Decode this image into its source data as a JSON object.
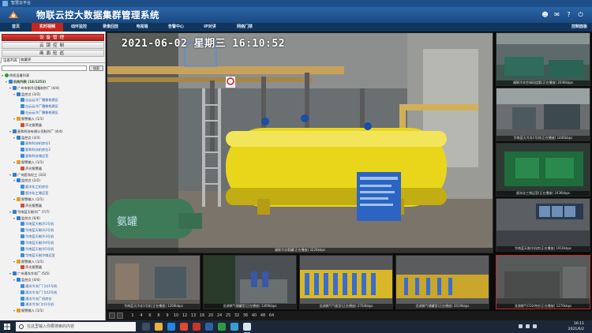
{
  "window": {
    "title": "智慧云平台"
  },
  "header": {
    "title": "物联云控大数据集群管理系统"
  },
  "nav": {
    "items": [
      "首页",
      "实时视频",
      "动环监控",
      "录像回放",
      "电视墙",
      "告警中心",
      "IP对讲",
      "网络门禁"
    ],
    "active_index": 1,
    "right_label": "控制面板"
  },
  "sidebar": {
    "buttons": [
      "设备管理",
      "云镜控制",
      "画面轮巡"
    ],
    "active_button": 0,
    "tabs": [
      "设备列表",
      "收藏夹"
    ],
    "search_button": "搜索",
    "tree": [
      {
        "level": 0,
        "icon": "person",
        "text": "授权设备列表",
        "style": "normal"
      },
      {
        "level": 1,
        "icon": "folder",
        "text": "机构列表 (18/1253)",
        "style": "bold"
      },
      {
        "level": 2,
        "icon": "folder",
        "text": "广州市制冷设备制作厂 (4/4)",
        "style": "normal"
      },
      {
        "level": 3,
        "icon": "folder",
        "text": "监控点 (3/3)",
        "style": "normal"
      },
      {
        "level": 4,
        "icon": "cam",
        "text": "自云云冷厂摄像枪建区",
        "style": "blue"
      },
      {
        "level": 4,
        "icon": "cam",
        "text": "白云云冷厂摄像枪建区",
        "style": "blue"
      },
      {
        "level": 4,
        "icon": "cam",
        "text": "白云云冷厂摄像枪建区",
        "style": "blue"
      },
      {
        "level": 3,
        "icon": "alarm",
        "text": "报警输入 (1/1)",
        "style": "normal"
      },
      {
        "level": 4,
        "icon": "bell",
        "text": "声光报警器",
        "style": "normal"
      },
      {
        "level": 2,
        "icon": "folder",
        "text": "星和科技有限公司制冷厂 (4/4)",
        "style": "normal"
      },
      {
        "level": 3,
        "icon": "folder",
        "text": "监控点 (3/3)",
        "style": "normal"
      },
      {
        "level": 4,
        "icon": "cam",
        "text": "星和科技机房仓1",
        "style": "blue"
      },
      {
        "level": 4,
        "icon": "cam",
        "text": "星和科技机房仓2",
        "style": "blue"
      },
      {
        "level": 4,
        "icon": "cam",
        "text": "星和科技储运室",
        "style": "blue"
      },
      {
        "level": 3,
        "icon": "alarm",
        "text": "报警输入 (1/1)",
        "style": "normal"
      },
      {
        "level": 4,
        "icon": "bell",
        "text": "声光报警器",
        "style": "normal"
      },
      {
        "level": 2,
        "icon": "folder",
        "text": "广州超冻化工 (3/3)",
        "style": "normal"
      },
      {
        "level": 3,
        "icon": "folder",
        "text": "监控点 (2/2)",
        "style": "normal"
      },
      {
        "level": 4,
        "icon": "cam",
        "text": "超冻化工机房仓",
        "style": "blue"
      },
      {
        "level": 4,
        "icon": "cam",
        "text": "超冻化工储运室",
        "style": "blue"
      },
      {
        "level": 3,
        "icon": "alarm",
        "text": "报警输入 (1/1)",
        "style": "normal"
      },
      {
        "level": 4,
        "icon": "bell",
        "text": "声光报警器",
        "style": "normal"
      },
      {
        "level": 2,
        "icon": "folder",
        "text": "华南蓝天制冷厂 (7/7)",
        "style": "normal"
      },
      {
        "level": 3,
        "icon": "folder",
        "text": "监控点 (6/6)",
        "style": "normal"
      },
      {
        "level": 4,
        "icon": "cam",
        "text": "华南蓝天制冷1号机",
        "style": "blue"
      },
      {
        "level": 4,
        "icon": "cam",
        "text": "华南蓝天制冷2号机",
        "style": "blue"
      },
      {
        "level": 4,
        "icon": "cam",
        "text": "华南蓝天制冷3号机",
        "style": "blue"
      },
      {
        "level": 4,
        "icon": "cam",
        "text": "华南蓝天制冷4号机",
        "style": "blue"
      },
      {
        "level": 4,
        "icon": "cam",
        "text": "华南蓝天制冷5号机",
        "style": "blue"
      },
      {
        "level": 4,
        "icon": "cam",
        "text": "华南蓝天制冷储运室",
        "style": "blue"
      },
      {
        "level": 3,
        "icon": "alarm",
        "text": "报警输入 (1/1)",
        "style": "normal"
      },
      {
        "level": 4,
        "icon": "bell",
        "text": "声光报警器",
        "style": "normal"
      },
      {
        "level": 2,
        "icon": "folder",
        "text": "广州通冻冷冻厂 (5/5)",
        "style": "normal"
      },
      {
        "level": 3,
        "icon": "folder",
        "text": "监控点 (4/4)",
        "style": "normal"
      },
      {
        "level": 4,
        "icon": "cam",
        "text": "通冻冷冻厂门口1号机",
        "style": "blue"
      },
      {
        "level": 4,
        "icon": "cam",
        "text": "通冻冷冻厂门口2号机",
        "style": "blue"
      },
      {
        "level": 4,
        "icon": "cam",
        "text": "通冻冷冻厂机房仓",
        "style": "blue"
      },
      {
        "level": 4,
        "icon": "cam",
        "text": "通冻冷冻门口1号机",
        "style": "blue"
      },
      {
        "level": 3,
        "icon": "alarm",
        "text": "报警输入 (1/1)",
        "style": "normal"
      }
    ]
  },
  "main_video": {
    "timestamp": "2021-06-02 星期三 16:10:52",
    "overlay_text": "氨罐",
    "caption": "福联冷冻氨罐(正在播放) 3226kbps"
  },
  "side_cameras": [
    {
      "caption": "福联冷冻空调机组氨(正在播放) 2046kbps"
    },
    {
      "caption": "华南蓝天冷冻1号机(正在播放) 1406kbps"
    },
    {
      "caption": "超冻化工储运室(正在播放) 2436kbps"
    },
    {
      "caption": "华南蓝天制冷机房(正在播放) 1910kbps"
    },
    {
      "caption": ""
    }
  ],
  "bottom_cameras": [
    {
      "caption": "华南蓝天冷冻1号机(正在播放) 1269kbps"
    },
    {
      "caption": "龙湖燃气储罐室(正在播放) 1369kbps"
    },
    {
      "caption": "龙湖燃气气瓶室(正在播放) 2764kbps"
    },
    {
      "caption": "龙湖燃气储罐室(正在播放) 2619kbps"
    },
    {
      "caption": "龙湖燃气CO2供应(正在播放) 1276kbps"
    }
  ],
  "pager": {
    "pages": [
      "1",
      "4",
      "6",
      "8",
      "9",
      "10",
      "12",
      "13",
      "16",
      "20",
      "24",
      "25",
      "32",
      "36",
      "40",
      "48",
      "64"
    ]
  },
  "taskbar": {
    "search_placeholder": "在这里输入你要搜索的内容",
    "time": "16:11",
    "date": "2021/6/2"
  }
}
